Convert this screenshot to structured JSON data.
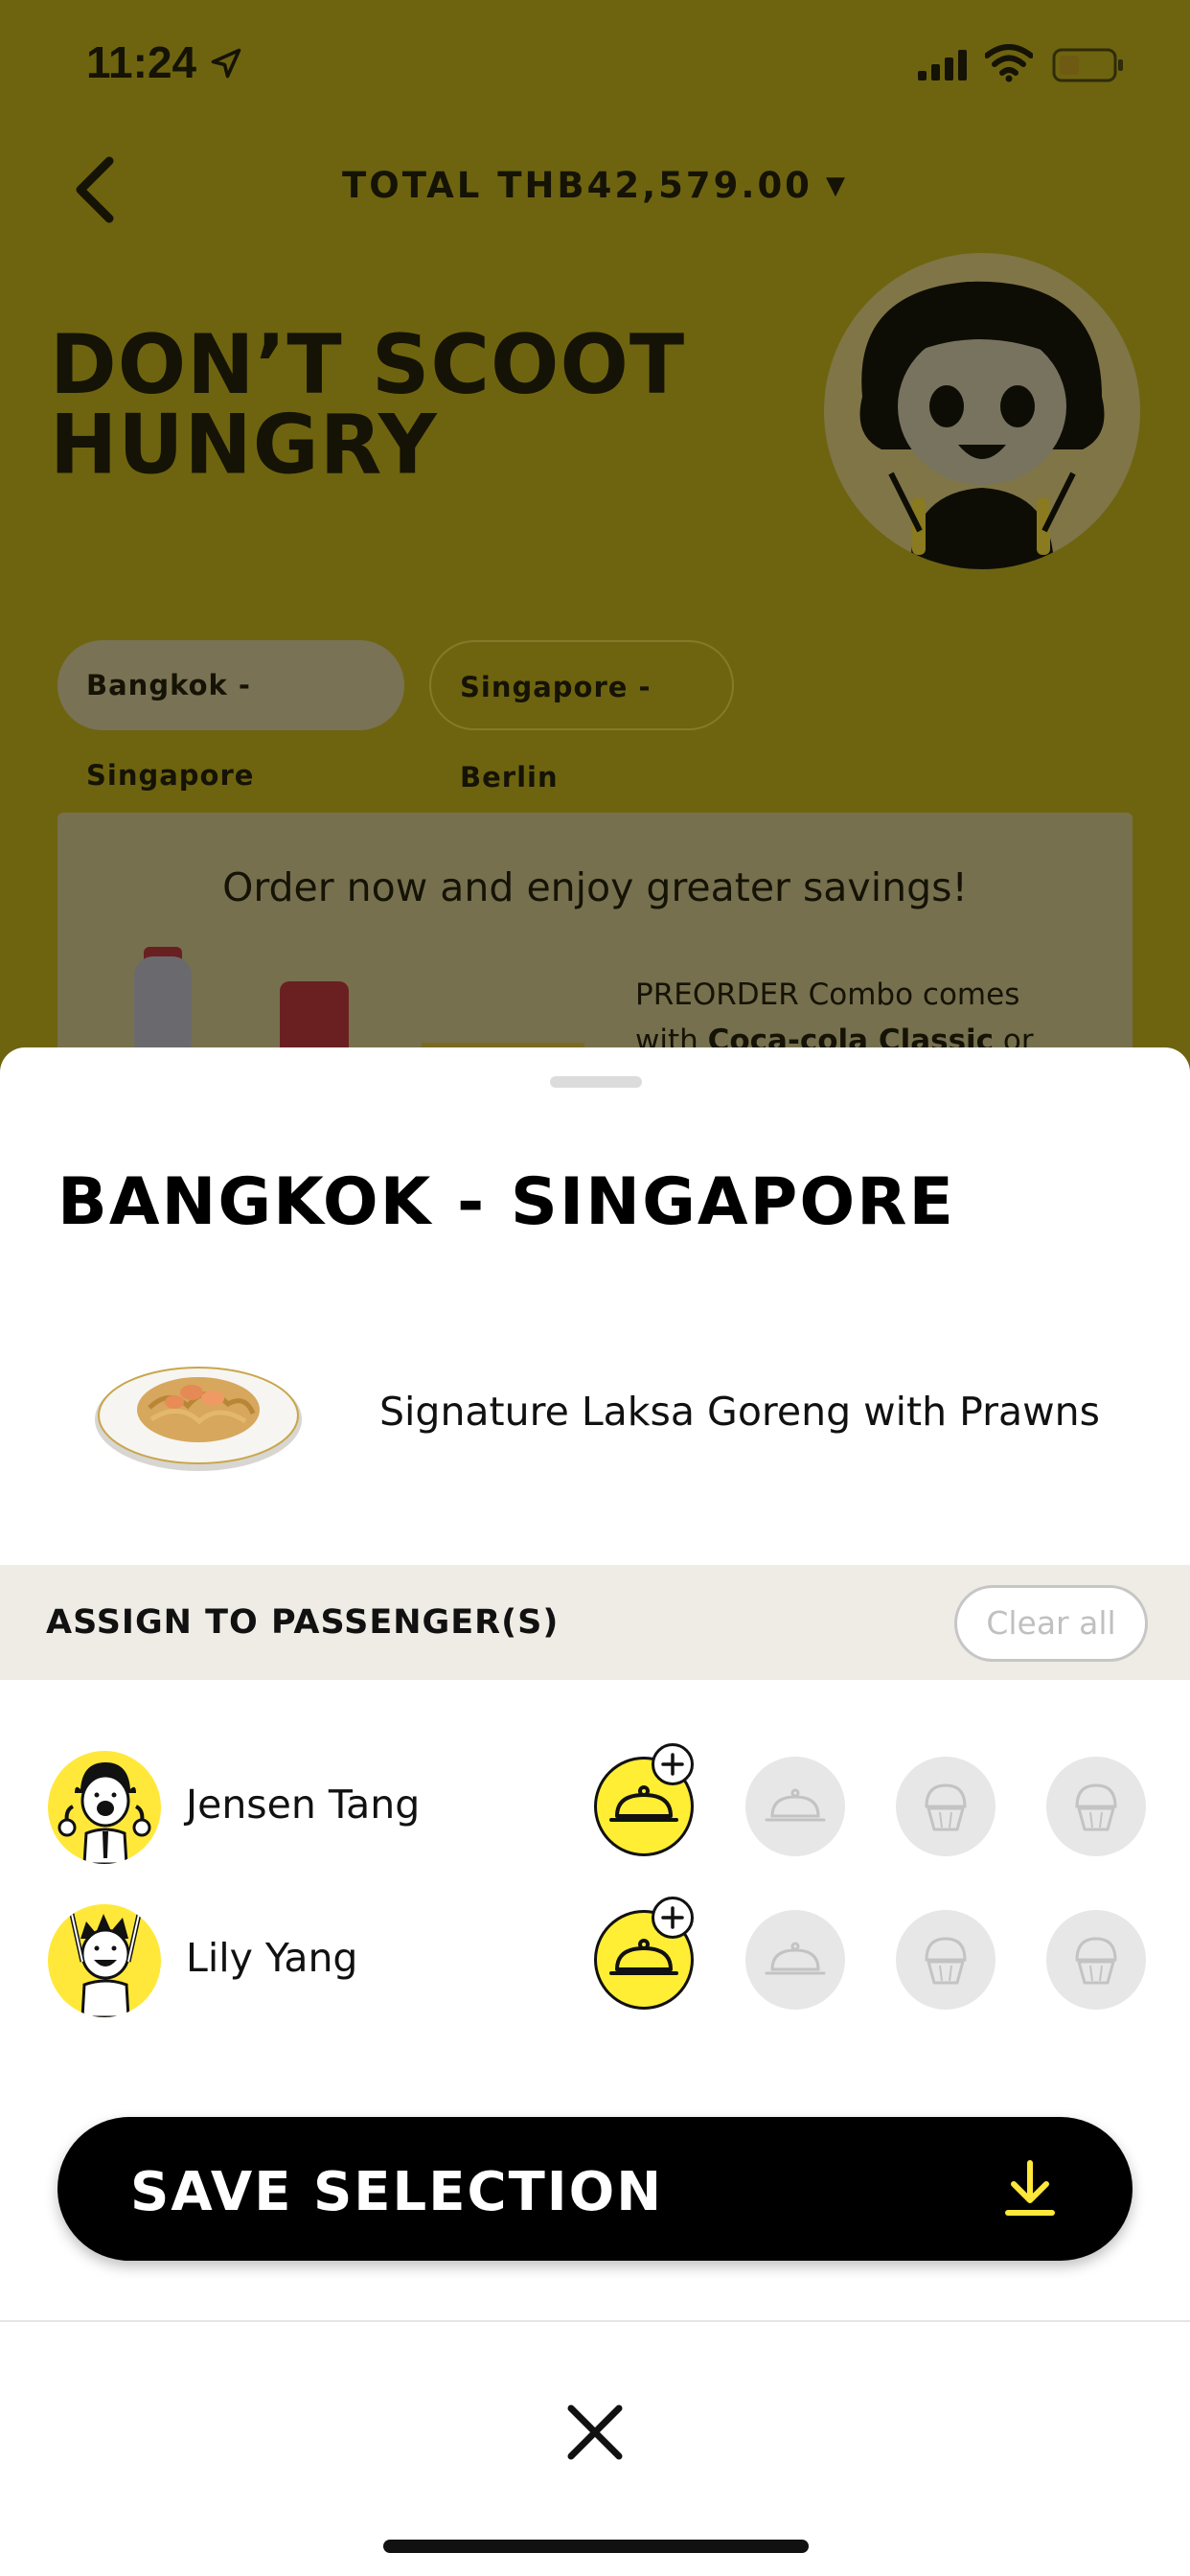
{
  "status_bar": {
    "time": "11:24"
  },
  "header": {
    "total_label": "TOTAL THB42,579.00",
    "caret": "▼"
  },
  "hero": {
    "title_line1": "DON’T SCOOT",
    "title_line2": "HUNGRY"
  },
  "routes": [
    {
      "label": "Bangkok - Singapore",
      "selected": true
    },
    {
      "label": "Singapore - Berlin",
      "selected": false
    }
  ],
  "promo": {
    "title": "Order now and enjoy greater savings!",
    "text_prefix": "PREORDER Combo comes",
    "text_line2_prefix": "with ",
    "text_bold": "Coca-cola Classic",
    "text_suffix": " or"
  },
  "sheet": {
    "title": "BANGKOK - SINGAPORE",
    "dish_name": "Signature Laksa Goreng with Prawns",
    "assign_label": "ASSIGN TO PASSENGER(S)",
    "clear_label": "Clear all",
    "passengers": [
      {
        "name": "Jensen Tang"
      },
      {
        "name": "Lily Yang"
      }
    ],
    "save_label": "SAVE SELECTION"
  },
  "colors": {
    "brand_yellow": "#ffe83a",
    "active_slot": "#ffee33",
    "dim_background": "#6e6410",
    "save_icon": "#ffe83a"
  },
  "icons": {
    "back": "chevron-left-icon",
    "meal_main": "cloche-icon",
    "meal_dessert": "cupcake-icon",
    "add": "plus-icon",
    "save": "download-icon",
    "close": "close-icon"
  }
}
